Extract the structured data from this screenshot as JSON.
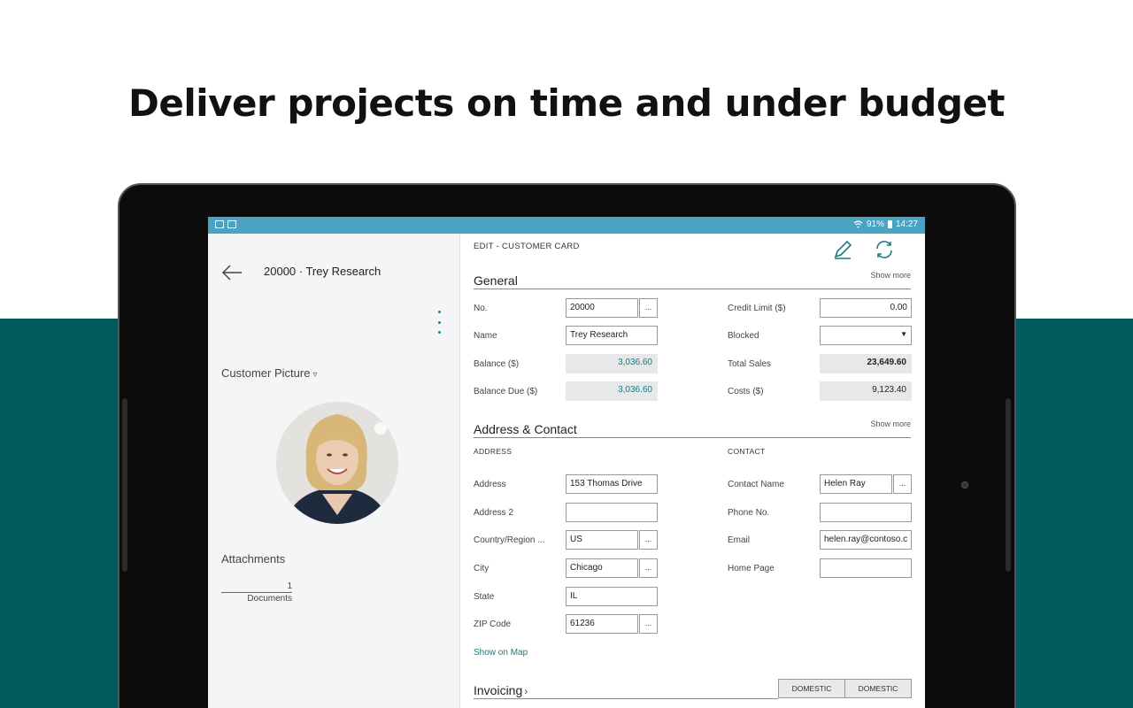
{
  "headline": "Deliver projects on time and under budget",
  "statusbar": {
    "battery": "91%",
    "time": "14:27"
  },
  "left_pane": {
    "record_title": "20000 · Trey Research",
    "picture_label": "Customer Picture",
    "attachments_label": "Attachments",
    "documents_count": "1",
    "documents_label": "Documents"
  },
  "main": {
    "breadcrumb": "EDIT - CUSTOMER CARD",
    "general": {
      "title": "General",
      "show_more": "Show more",
      "no_label": "No.",
      "no_value": "20000",
      "name_label": "Name",
      "name_value": "Trey Research",
      "balance_label": "Balance ($)",
      "balance_value": "3,036.60",
      "balance_due_label": "Balance Due ($)",
      "balance_due_value": "3,036.60",
      "credit_limit_label": "Credit Limit ($)",
      "credit_limit_value": "0.00",
      "blocked_label": "Blocked",
      "blocked_value": "",
      "total_sales_label": "Total Sales",
      "total_sales_value": "23,649.60",
      "costs_label": "Costs ($)",
      "costs_value": "9,123.40"
    },
    "address_contact": {
      "title": "Address & Contact",
      "show_more": "Show more",
      "address_head": "ADDRESS",
      "contact_head": "CONTACT",
      "address_label": "Address",
      "address_value": "153 Thomas Drive",
      "address2_label": "Address 2",
      "address2_value": "",
      "country_label": "Country/Region ...",
      "country_value": "US",
      "city_label": "City",
      "city_value": "Chicago",
      "state_label": "State",
      "state_value": "IL",
      "zip_label": "ZIP Code",
      "zip_value": "61236",
      "contact_name_label": "Contact Name",
      "contact_name_value": "Helen Ray",
      "phone_label": "Phone No.",
      "phone_value": "",
      "email_label": "Email",
      "email_value": "helen.ray@contoso.c",
      "homepage_label": "Home Page",
      "homepage_value": "",
      "map_link": "Show on Map"
    },
    "invoicing": {
      "title": "Invoicing",
      "btn1": "DOMESTIC",
      "btn2": "DOMESTIC"
    },
    "assist_glyph": "..."
  },
  "colors": {
    "teal_bg": "#005a5e",
    "status_bar": "#4aa3c0",
    "accent": "#1a7a7e"
  }
}
